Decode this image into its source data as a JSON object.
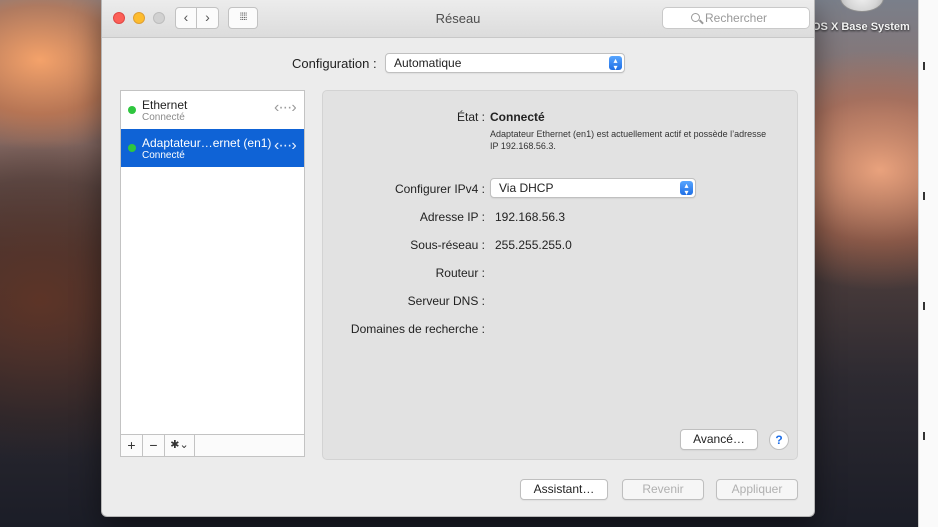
{
  "desktop": {
    "disk_label": "OS X Base System"
  },
  "window": {
    "title": "Réseau",
    "search_placeholder": "Rechercher"
  },
  "configuration": {
    "label": "Configuration :",
    "value": "Automatique"
  },
  "services": [
    {
      "name": "Ethernet",
      "status": "Connecté",
      "selected": false
    },
    {
      "name": "Adaptateur…ernet (en1)",
      "status": "Connecté",
      "selected": true
    }
  ],
  "list_toolbar": {
    "add": "+",
    "remove": "−",
    "gear": "✱⌄"
  },
  "detail": {
    "state_label": "État :",
    "state_value": "Connecté",
    "state_description": "Adaptateur Ethernet (en1) est actuellement actif et possède l’adresse IP 192.168.56.3.",
    "ipv4_label": "Configurer IPv4 :",
    "ipv4_value": "Via DHCP",
    "ip_label": "Adresse IP :",
    "ip_value": "192.168.56.3",
    "mask_label": "Sous-réseau :",
    "mask_value": "255.255.255.0",
    "router_label": "Routeur :",
    "dns_label": "Serveur DNS :",
    "search_domains_label": "Domaines de recherche :",
    "advanced_button": "Avancé…",
    "help_button": "?"
  },
  "footer": {
    "assistant_button": "Assistant…",
    "revert_button": "Revenir",
    "apply_button": "Appliquer"
  },
  "colors": {
    "selection": "#0f63d6",
    "status_connected": "#2fc63f",
    "popup_accent": "#1f6fe5"
  }
}
